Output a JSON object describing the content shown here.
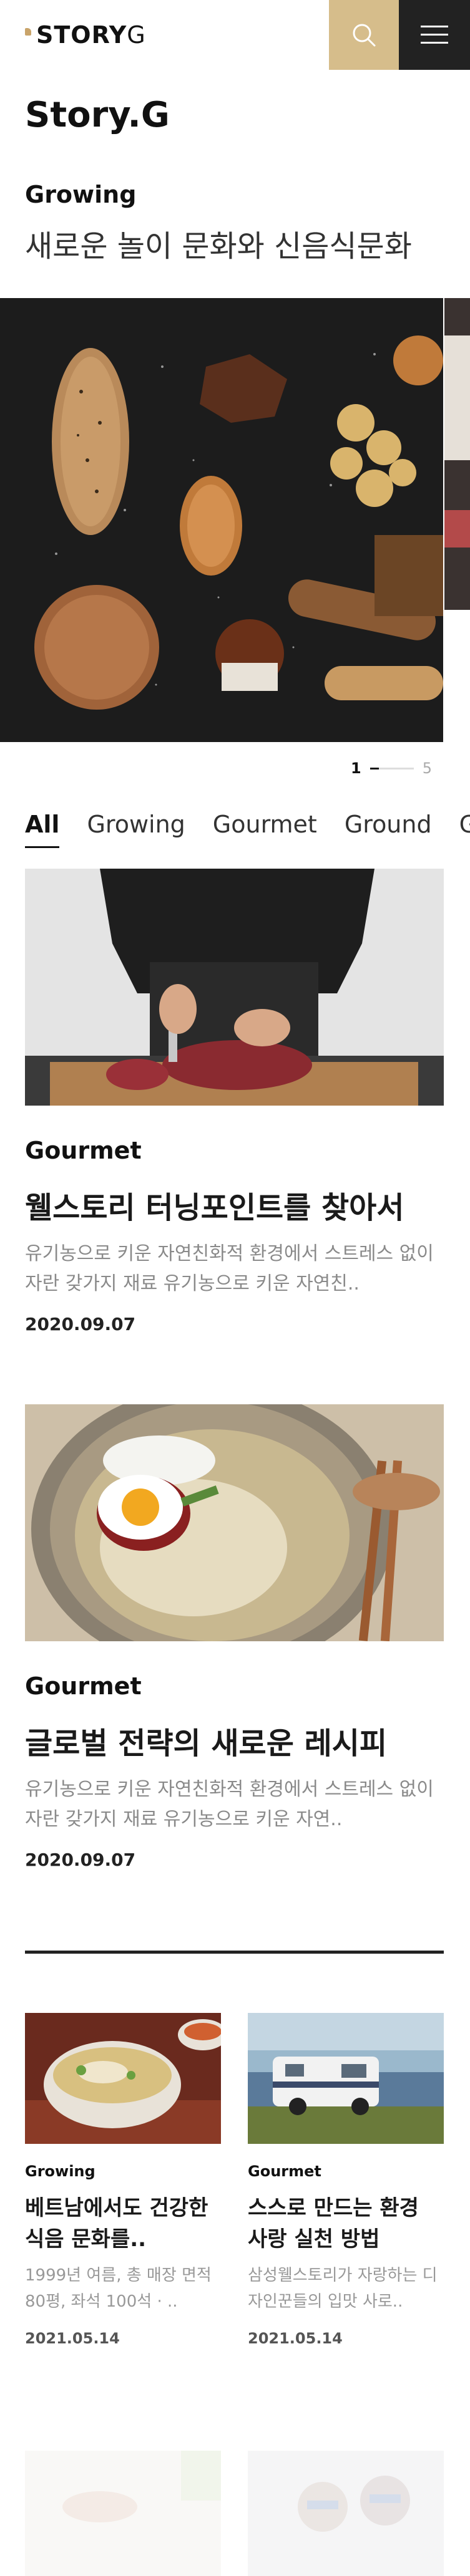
{
  "header": {
    "brand_bold": "STORY",
    "brand_light": "G",
    "search_icon": "search-icon",
    "menu_icon": "hamburger-icon",
    "accent_color": "#d6bd8b",
    "menu_bg": "#222222"
  },
  "page": {
    "title": "Story.G"
  },
  "hero": {
    "category": "Growing",
    "subtitle": "새로운 놀이 문화와 신음식문화",
    "pager": {
      "current": "1",
      "total": "5",
      "progress": 0.2
    }
  },
  "tabs": [
    "All",
    "Growing",
    "Gourmet",
    "Ground",
    "Go"
  ],
  "featured": [
    {
      "category": "Gourmet",
      "title": "웰스토리 터닝포인트를 찾아서",
      "description": "유기농으로 키운 자연친화적 환경에서 스트레스 없이 자란 갖가지 재료 유기농으로 키운 자연친..",
      "date": "2020.09.07"
    },
    {
      "category": "Gourmet",
      "title": "글로벌 전략의 새로운 레시피",
      "description": "유기농으로 키운 자연친화적 환경에서 스트레스 없이 자란 갖가지 재료 유기농으로 키운 자연..",
      "date": "2020.09.07"
    }
  ],
  "grid": [
    {
      "category": "Growing",
      "title": "베트남에서도 건강한 식음 문화를..",
      "description": "1999년 여름, 총 매장 면적 80평, 좌석 100석 · ..",
      "date": "2021.05.14"
    },
    {
      "category": "Gourmet",
      "title": "스스로 만드는 환경 사랑 실천 방법",
      "description": "삼성웰스토리가 자랑하는 디자인꾼들의 입맛 사로..",
      "date": "2021.05.14"
    }
  ]
}
